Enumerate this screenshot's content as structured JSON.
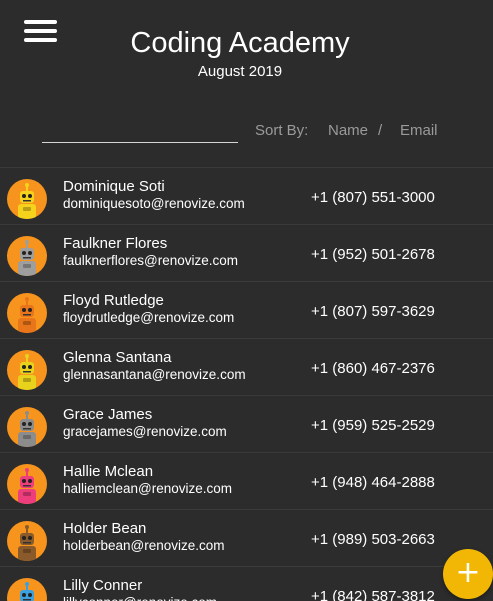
{
  "header": {
    "menu_icon": "hamburger-menu-icon",
    "title": "Coding Academy",
    "subtitle": "August 2019"
  },
  "search": {
    "value": "",
    "placeholder": ""
  },
  "sort": {
    "label": "Sort By:",
    "options": [
      "Name",
      "Email"
    ],
    "separator": "/"
  },
  "contacts": [
    {
      "name": "Dominique Soti",
      "email": "dominiquesoto@renovize.com",
      "phone": "+1 (807) 551-3000",
      "avatar_color": "#f7941d",
      "robot_color": "#f5d31c"
    },
    {
      "name": "Faulkner Flores",
      "email": "faulknerflores@renovize.com",
      "phone": "+1 (952) 501-2678",
      "avatar_color": "#f7941d",
      "robot_color": "#9e9e9e"
    },
    {
      "name": "Floyd Rutledge",
      "email": "floydrutledge@renovize.com",
      "phone": "+1 (807) 597-3629",
      "avatar_color": "#f7941d",
      "robot_color": "#e8751a"
    },
    {
      "name": "Glenna Santana",
      "email": "glennasantana@renovize.com",
      "phone": "+1 (860) 467-2376",
      "avatar_color": "#f7941d",
      "robot_color": "#e8d21c"
    },
    {
      "name": "Grace James",
      "email": "gracejames@renovize.com",
      "phone": "+1 (959) 525-2529",
      "avatar_color": "#f7941d",
      "robot_color": "#8c8c8c"
    },
    {
      "name": "Hallie Mclean",
      "email": "halliemclean@renovize.com",
      "phone": "+1 (948) 464-2888",
      "avatar_color": "#f7941d",
      "robot_color": "#ee3d7d"
    },
    {
      "name": "Holder Bean",
      "email": "holderbean@renovize.com",
      "phone": "+1 (989) 503-2663",
      "avatar_color": "#f7941d",
      "robot_color": "#8b5a2b"
    },
    {
      "name": "Lilly Conner",
      "email": "lillyconner@renovize.com",
      "phone": "+1 (842) 587-3812",
      "avatar_color": "#f7941d",
      "robot_color": "#3aa0e0"
    }
  ],
  "fab": {
    "label": "+",
    "color": "#f2b705",
    "icon": "plus-icon"
  },
  "colors": {
    "background": "#2c2c2c",
    "text": "#ffffff",
    "muted": "#9a9a9a",
    "accent": "#f2b705"
  }
}
